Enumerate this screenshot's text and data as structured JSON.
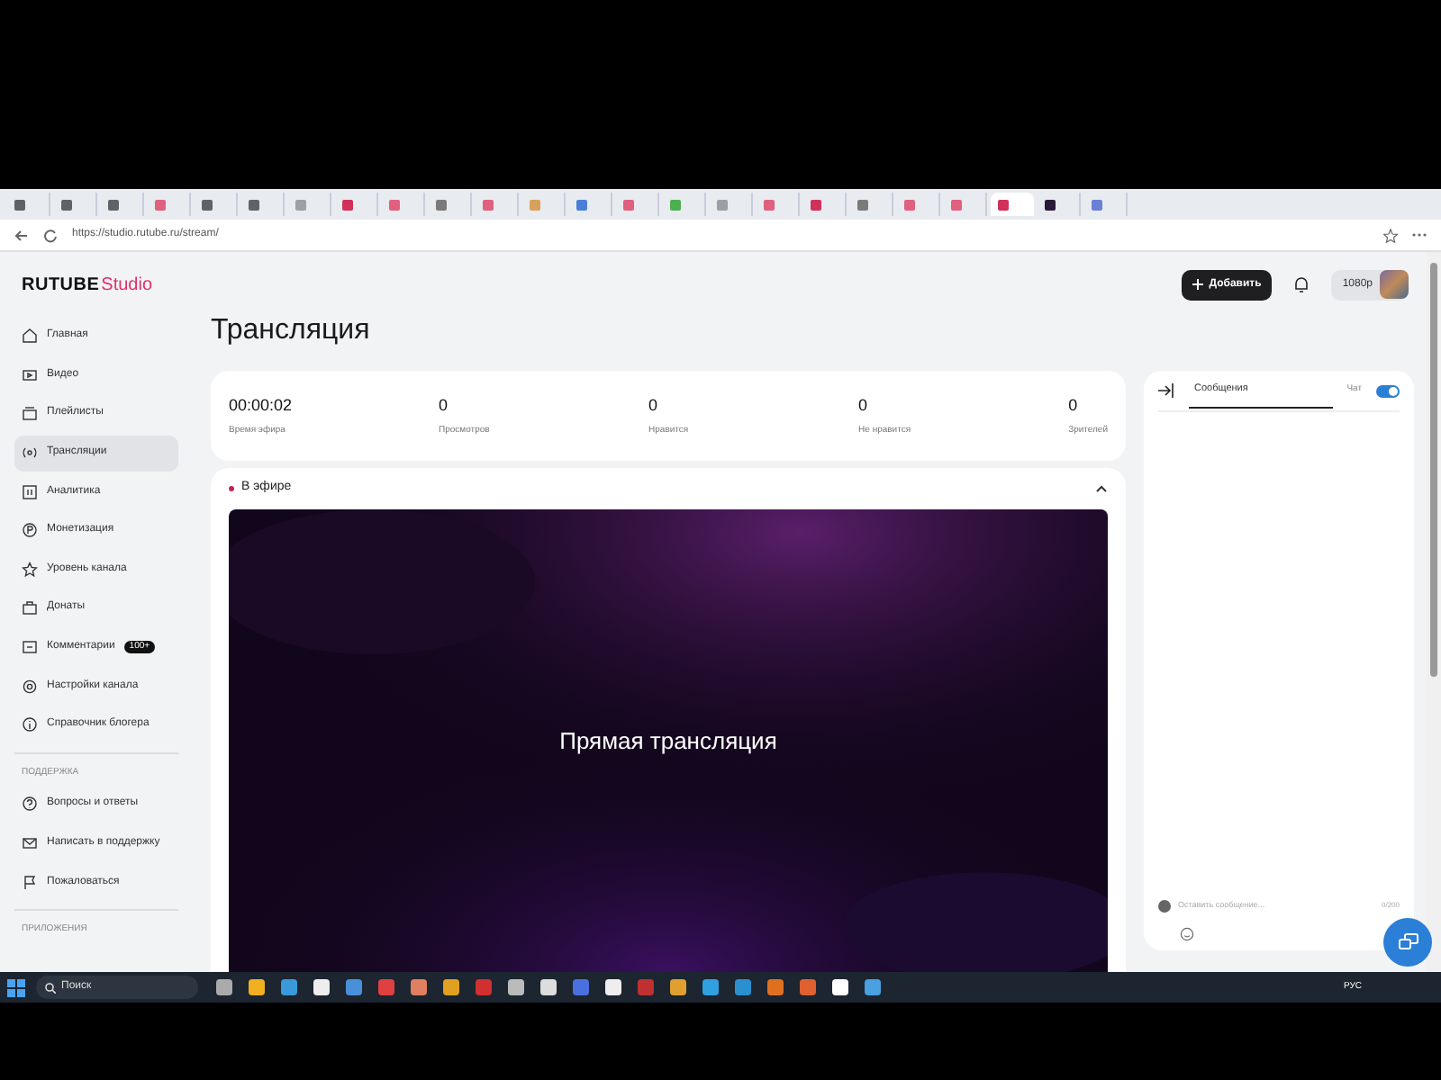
{
  "browser": {
    "tabs": [
      {
        "selected": false,
        "color": "#5f6368"
      },
      {
        "selected": false,
        "color": "#5f6368"
      },
      {
        "selected": false,
        "color": "#5f6368"
      },
      {
        "selected": false,
        "color": "#e0607e"
      },
      {
        "selected": false,
        "color": "#5f6368"
      },
      {
        "selected": false,
        "color": "#5f6368"
      },
      {
        "selected": false,
        "color": "#9aa0a6"
      },
      {
        "selected": false,
        "color": "#d0305a"
      },
      {
        "selected": false,
        "color": "#e0607e"
      },
      {
        "selected": false,
        "color": "#7a7a7a"
      },
      {
        "selected": false,
        "color": "#e0607e"
      },
      {
        "selected": false,
        "color": "#d9a05b"
      },
      {
        "selected": false,
        "color": "#4a7fd6"
      },
      {
        "selected": false,
        "color": "#e0607e"
      },
      {
        "selected": false,
        "color": "#4caf50"
      },
      {
        "selected": false,
        "color": "#9aa0a6"
      },
      {
        "selected": false,
        "color": "#e0607e"
      },
      {
        "selected": false,
        "color": "#d0305a"
      },
      {
        "selected": false,
        "color": "#7a7a7a"
      },
      {
        "selected": false,
        "color": "#e0607e"
      },
      {
        "selected": false,
        "color": "#e0607e"
      },
      {
        "selected": true,
        "color": "#d0305a"
      },
      {
        "selected": false,
        "color": "#2a1a3a"
      },
      {
        "selected": false,
        "color": "#6a7fd6"
      }
    ],
    "url": "https://studio.rutube.ru/stream/"
  },
  "logo": {
    "brand": "RUTUBE",
    "product": "Studio"
  },
  "sidebar": {
    "items": [
      {
        "label": "Главная",
        "selected": false
      },
      {
        "label": "Видео",
        "selected": false
      },
      {
        "label": "Плейлисты",
        "selected": false
      },
      {
        "label": "Трансляции",
        "selected": true
      },
      {
        "label": "Аналитика",
        "selected": false
      },
      {
        "label": "Монетизация",
        "selected": false
      },
      {
        "label": "Уровень канала",
        "selected": false
      },
      {
        "label": "Донаты",
        "selected": false
      },
      {
        "label": "Комментарии",
        "selected": false,
        "badge": "100+"
      },
      {
        "label": "Настройки канала",
        "selected": false
      },
      {
        "label": "Справочник блогера",
        "selected": false
      }
    ],
    "support_heading": "ПОДДЕРЖКА",
    "support_items": [
      {
        "label": "Вопросы и ответы"
      },
      {
        "label": "Написать в поддержку"
      },
      {
        "label": "Пожаловаться"
      }
    ],
    "apps_heading": "ПРИЛОЖЕНИЯ"
  },
  "header": {
    "add_button": "Добавить",
    "quality": "1080p"
  },
  "page_title": "Трансляция",
  "stats": [
    {
      "value": "00:00:02",
      "label": "Время эфира"
    },
    {
      "value": "0",
      "label": "Просмотров"
    },
    {
      "value": "0",
      "label": "Нравится"
    },
    {
      "value": "0",
      "label": "Не нравится"
    },
    {
      "value": "0",
      "label": "Зрителей"
    }
  ],
  "live": {
    "status": "В эфире",
    "expanded": true,
    "player_text": "Прямая трансляция"
  },
  "chat": {
    "tab": "Сообщения",
    "toggle_label": "Чат",
    "toggle_on": true,
    "placeholder": "Оставить сообщение...",
    "counter": "0/200"
  },
  "taskbar": {
    "search": "Поиск",
    "language": "РУС"
  }
}
